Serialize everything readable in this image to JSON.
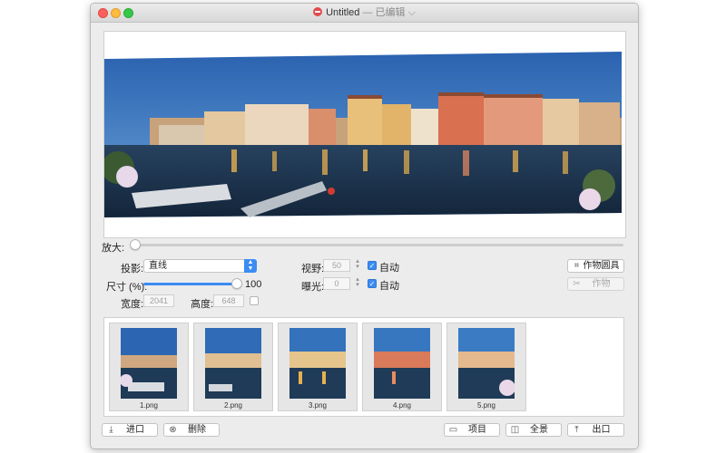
{
  "window": {
    "title": "Untitled",
    "title_status": "— 已编辑",
    "title_chevron": "⌵"
  },
  "controls": {
    "zoom_label": "放大:",
    "projection_label": "投影:",
    "projection_value": "直线",
    "size_label": "尺寸 (%):",
    "size_value": "100",
    "size_fraction": 0.95,
    "width_label": "宽度:",
    "width_value": "2041",
    "height_label": "高度:",
    "height_value": "648",
    "fov_label": "视野:",
    "fov_value": "50",
    "exposure_label": "曝光:",
    "exposure_value": "0",
    "auto_label": "自动",
    "crop_tool_label": "作物圆具",
    "crop_label": "作物"
  },
  "thumbnails": [
    {
      "label": "1.png"
    },
    {
      "label": "2.png"
    },
    {
      "label": "3.png"
    },
    {
      "label": "4.png"
    },
    {
      "label": "5.png"
    }
  ],
  "bottom_buttons": {
    "import_label": "进口",
    "delete_label": "删除",
    "project_label": "项目",
    "panorama_label": "全景",
    "export_label": "出口"
  },
  "colors": {
    "accent": "#3b8cf3",
    "sky": "#2f6fb8",
    "water": "#1d3650"
  }
}
